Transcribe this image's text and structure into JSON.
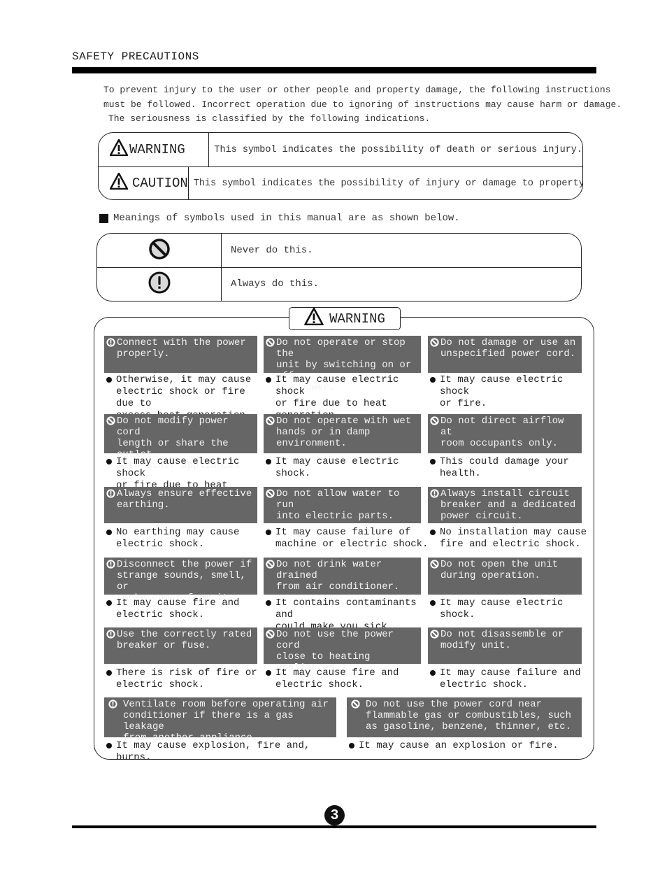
{
  "header": {
    "title": "SAFETY PRECAUTIONS"
  },
  "intro": {
    "lines": [
      "To prevent injury to the user or other people and property damage, the following  instructions",
      "must be followed. Incorrect operation due to ignoring of instructions may cause harm or damage.",
      "The seriousness is classified by the following indications."
    ]
  },
  "signal_words": [
    {
      "icon": "warning-triangle-icon",
      "label": "WARNING",
      "description": "This symbol indicates the possibility of death or serious injury."
    },
    {
      "icon": "warning-triangle-icon",
      "label": "CAUTION",
      "description": "This symbol indicates the possibility of injury or damage to property."
    }
  ],
  "symbols_section": {
    "label": "Meanings of symbols used in this manual are as shown below.",
    "rows": [
      {
        "icon": "prohibited-icon",
        "meaning": "Never do this."
      },
      {
        "icon": "mandatory-icon",
        "meaning": "Always do this."
      }
    ]
  },
  "warning_section": {
    "title": "WARNING",
    "cards": [
      {
        "type": "mandatory",
        "instruction": "Connect with the power\nproperly.",
        "consequence": "Otherwise, it may cause\nelectric shock or fire due to\nexcess heat generation."
      },
      {
        "type": "prohibited",
        "instruction": "Do not operate or stop the\nunit by switching on or off\nthe power.",
        "consequence": "It may cause electric shock\nor fire due to heat generation."
      },
      {
        "type": "prohibited",
        "instruction": "Do not damage or use an\nunspecified power cord.",
        "consequence": "It may cause electric shock\nor fire."
      },
      {
        "type": "prohibited",
        "instruction": "Do not modify power cord\nlength or share the outlet\nwith other appliances",
        "consequence": "It may cause electric shock\nor fire due to heat generation."
      },
      {
        "type": "prohibited",
        "instruction": "Do not operate with wet\nhands or in damp\nenvironment.",
        "consequence": "It may cause electric shock."
      },
      {
        "type": "prohibited",
        "instruction": "Do not direct airflow at\nroom occupants only.",
        "consequence": "This could damage your\nhealth."
      },
      {
        "type": "mandatory",
        "instruction": "Always ensure effective\nearthing.",
        "consequence": "No earthing may cause\nelectric shock."
      },
      {
        "type": "prohibited",
        "instruction": "Do not allow water to run\ninto electric parts.",
        "consequence": "It may cause failure of\nmachine or electric shock."
      },
      {
        "type": "mandatory",
        "instruction": "Always install circuit\nbreaker and a dedicated\npower circuit.",
        "consequence": "No installation may cause\nfire and electric shock."
      },
      {
        "type": "mandatory",
        "instruction": "Disconnect the power if\nstrange sounds, smell, or\nsmoke comes from it.",
        "consequence": "It may cause fire and\nelectric shock."
      },
      {
        "type": "prohibited",
        "instruction": "Do not drink water drained\nfrom air conditioner.",
        "consequence": "It contains contaminants and\ncould make you sick."
      },
      {
        "type": "prohibited",
        "instruction": "Do not open the unit\nduring operation.",
        "consequence": "It may cause electric shock."
      },
      {
        "type": "mandatory",
        "instruction": "Use the correctly rated\nbreaker or fuse.",
        "consequence": "There is risk of fire or\nelectric shock."
      },
      {
        "type": "prohibited",
        "instruction": "Do not use the power cord\nclose to heating appliances.",
        "consequence": "It may cause fire and\nelectric shock."
      },
      {
        "type": "prohibited",
        "instruction": "Do not disassemble or\nmodify unit.",
        "consequence": "It may cause failure and\nelectric shock."
      },
      {
        "type": "mandatory",
        "instruction": "Ventilate room before operating air\nconditioner if there is a gas leakage\nfrom another appliance.",
        "consequence": "It may cause explosion, fire and, burns."
      },
      {
        "type": "prohibited",
        "instruction": "Do not use the power cord near\nflammable gas or combustibles, such\nas gasoline, benzene, thinner, etc.",
        "consequence": "It may cause an explosion or fire."
      }
    ]
  },
  "footer": {
    "page_number": "3"
  },
  "colors": {
    "card_header_bg": "#666666",
    "card_header_text": "#f2f2f2",
    "rule": "#000000"
  }
}
